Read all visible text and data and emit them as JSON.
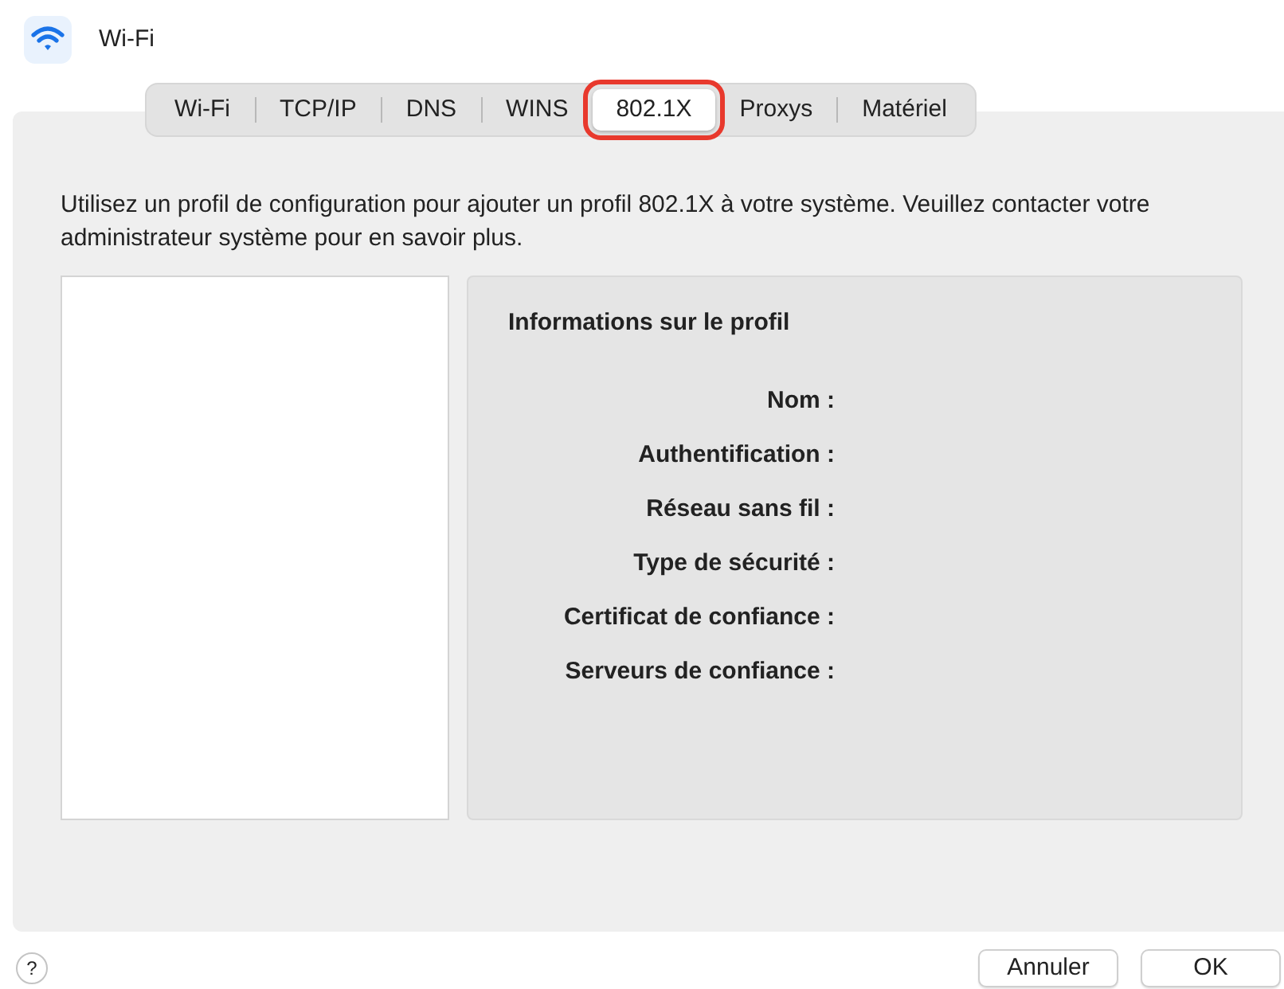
{
  "window": {
    "title": "Wi-Fi"
  },
  "tabs": [
    {
      "label": "Wi-Fi",
      "selected": false,
      "highlighted": false
    },
    {
      "label": "TCP/IP",
      "selected": false,
      "highlighted": false
    },
    {
      "label": "DNS",
      "selected": false,
      "highlighted": false
    },
    {
      "label": "WINS",
      "selected": false,
      "highlighted": false
    },
    {
      "label": "802.1X",
      "selected": true,
      "highlighted": true
    },
    {
      "label": "Proxys",
      "selected": false,
      "highlighted": false
    },
    {
      "label": "Matériel",
      "selected": false,
      "highlighted": false
    }
  ],
  "description": "Utilisez un profil de configuration pour ajouter un profil 802.1X à votre système. Veuillez contacter votre administrateur système pour en savoir plus.",
  "profile_info": {
    "title": "Informations sur le profil",
    "fields": [
      {
        "label": "Nom :"
      },
      {
        "label": "Authentification :"
      },
      {
        "label": "Réseau sans fil :"
      },
      {
        "label": "Type de sécurité :"
      },
      {
        "label": "Certificat de confiance :"
      },
      {
        "label": "Serveurs de confiance :"
      }
    ]
  },
  "help_button": "?",
  "buttons": [
    "Annuler",
    "OK"
  ]
}
